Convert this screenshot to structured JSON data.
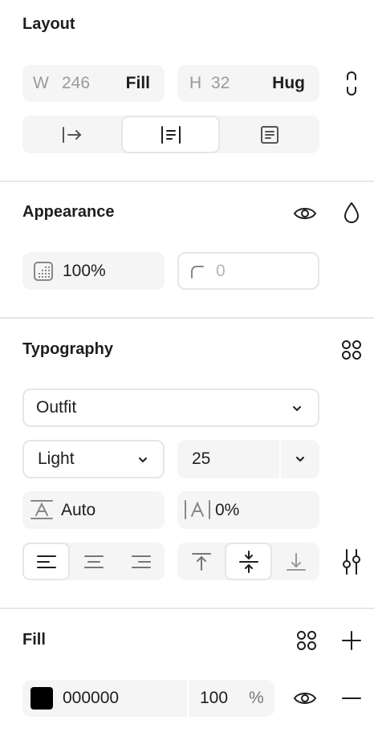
{
  "layout": {
    "title": "Layout",
    "width": {
      "prefix": "W",
      "value": "246",
      "mode": "Fill"
    },
    "height": {
      "prefix": "H",
      "value": "32",
      "mode": "Hug"
    },
    "constrain_icon": "link-chain-icon",
    "alignment_options": [
      "align-start-icon",
      "align-center-icon",
      "align-text-icon"
    ],
    "alignment_selected": 1
  },
  "appearance": {
    "title": "Appearance",
    "opacity": "100%",
    "corner_radius_placeholder": "0",
    "visibility_icon": "eye-icon",
    "blend_icon": "droplet-icon"
  },
  "typography": {
    "title": "Typography",
    "styles_icon": "grid-dots-icon",
    "font_family": "Outfit",
    "font_weight": "Light",
    "font_size": "25",
    "line_height": "Auto",
    "letter_spacing": "0%",
    "text_align_selected": "left",
    "vertical_align_selected": "center",
    "settings_icon": "sliders-icon"
  },
  "fill": {
    "title": "Fill",
    "color_hex": "000000",
    "swatch_color": "#000000",
    "opacity_value": "100",
    "opacity_unit": "%",
    "styles_icon": "grid-dots-icon",
    "add_icon": "plus-icon",
    "visibility_icon": "eye-icon",
    "remove_icon": "minus-icon"
  }
}
